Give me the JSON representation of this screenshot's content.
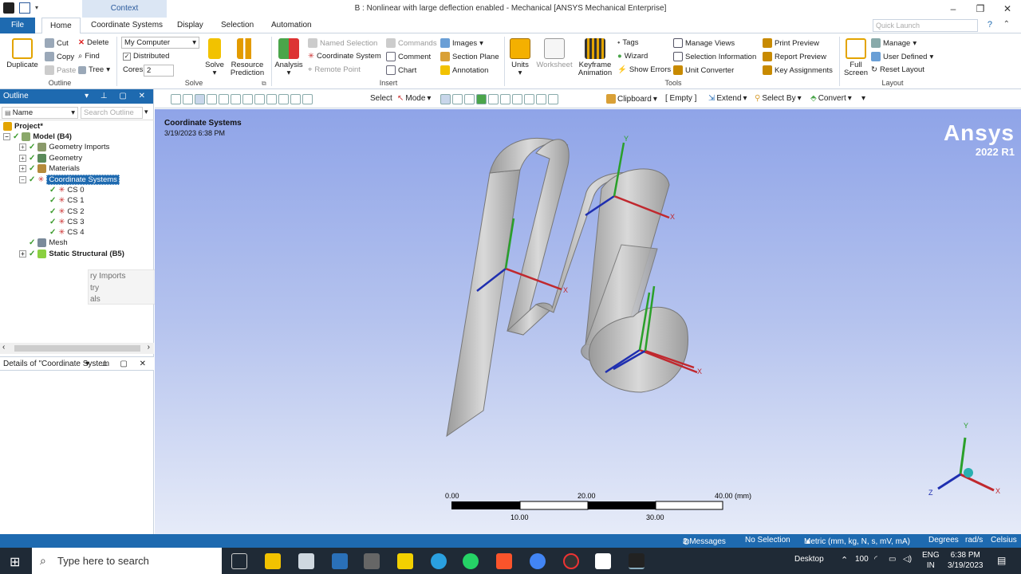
{
  "window": {
    "title": "B : Nonlinear with large deflection enabled - Mechanical [ANSYS Mechanical Enterprise]",
    "context_tab": "Context"
  },
  "menu": {
    "file": "File",
    "tabs": [
      "Home",
      "Coordinate Systems",
      "Display",
      "Selection",
      "Automation"
    ],
    "quick_launch_placeholder": "Quick Launch"
  },
  "ribbon": {
    "outline": {
      "label": "Outline",
      "duplicate": "Duplicate",
      "cut": "Cut",
      "copy": "Copy",
      "paste": "Paste",
      "delete": "Delete",
      "find": "Find",
      "tree": "Tree"
    },
    "solve": {
      "label": "Solve",
      "computer": "My Computer",
      "distributed": "Distributed",
      "cores_label": "Cores",
      "cores_value": "2",
      "solve_btn": "Solve",
      "resource_prediction_line1": "Resource",
      "resource_prediction_line2": "Prediction"
    },
    "insert": {
      "label": "Insert",
      "analysis": "Analysis",
      "named_selection": "Named Selection",
      "coordinate_system": "Coordinate System",
      "remote_point": "Remote Point",
      "commands": "Commands",
      "comment": "Comment",
      "chart": "Chart",
      "images": "Images",
      "section_plane": "Section Plane",
      "annotation": "Annotation"
    },
    "tools": {
      "label": "Tools",
      "units": "Units",
      "worksheet": "Worksheet",
      "keyframe_line1": "Keyframe",
      "keyframe_line2": "Animation",
      "tags": "Tags",
      "wizard": "Wizard",
      "show_errors": "Show Errors",
      "manage_views": "Manage Views",
      "selection_information": "Selection Information",
      "unit_converter": "Unit Converter",
      "print_preview": "Print Preview",
      "report_preview": "Report Preview",
      "key_assignments": "Key Assignments"
    },
    "layout": {
      "label": "Layout",
      "full_screen_line1": "Full",
      "full_screen_line2": "Screen",
      "manage": "Manage",
      "user_defined": "User Defined",
      "reset_layout": "Reset Layout"
    }
  },
  "outline_pane": {
    "title": "Outline",
    "name_filter": "Name",
    "search_placeholder": "Search Outline",
    "tree": {
      "project": "Project*",
      "model": "Model (B4)",
      "geometry_imports": "Geometry Imports",
      "geometry": "Geometry",
      "materials": "Materials",
      "coordinate_systems": "Coordinate Systems",
      "cs": [
        "CS 0",
        "CS 1",
        "CS 2",
        "CS 3",
        "CS 4"
      ],
      "mesh": "Mesh",
      "static_structural": "Static Structural (B5)"
    },
    "popup_lines": [
      "ry Imports",
      "try",
      "als"
    ]
  },
  "details_pane": {
    "title": "Details of \"Coordinate System"
  },
  "view_toolbar": {
    "select": "Select",
    "mode": "Mode",
    "clipboard": "Clipboard",
    "empty": "[ Empty ]",
    "extend": "Extend",
    "select_by": "Select By",
    "convert": "Convert"
  },
  "viewport": {
    "title": "Coordinate Systems",
    "date": "3/19/2023 6:38 PM",
    "brand": "Ansys",
    "version": "2022 R1",
    "scale": {
      "ticks_top": [
        "0.00",
        "20.00",
        "40.00 (mm)"
      ],
      "ticks_bottom": [
        "10.00",
        "30.00"
      ]
    },
    "triad": {
      "x": "X",
      "y": "Y",
      "z": "Z"
    }
  },
  "statusbar": {
    "messages": "2 Messages",
    "selection": "No Selection",
    "units": "Metric (mm, kg, N, s, mV, mA)",
    "angle": "Degrees",
    "rate": "rad/s",
    "temp": "Celsius"
  },
  "taskbar": {
    "search_placeholder": "Type here to search",
    "desktop": "Desktop",
    "lang_line1": "ENG",
    "lang_line2": "IN",
    "time": "6:38 PM",
    "date": "3/19/2023",
    "volume_pct": "100"
  },
  "colors": {
    "accent": "#1e6ab0",
    "x_axis": "#c0282e",
    "y_axis": "#2aa02a",
    "z_axis": "#1f2fb0"
  }
}
